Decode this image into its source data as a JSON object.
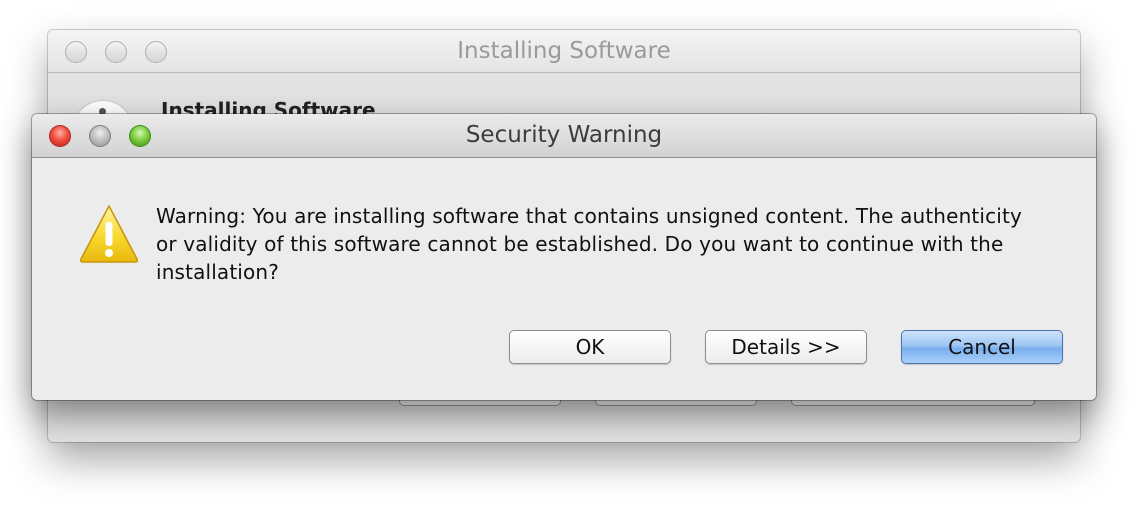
{
  "background_window": {
    "title": "Installing Software",
    "heading": "Installing Software"
  },
  "dialog": {
    "title": "Security Warning",
    "message": "Warning: You are installing software that contains unsigned content. The authenticity or validity of this software cannot be established. Do you want to continue with the installation?",
    "icon": "warning-triangle-icon",
    "buttons": {
      "ok": "OK",
      "details": "Details >>",
      "cancel": "Cancel"
    }
  },
  "colors": {
    "close": "#f24f43",
    "minimize": "#bdbdbd",
    "maximize": "#77c93a",
    "default_button": "#9ec5f5",
    "warning": "#f6d21c"
  }
}
